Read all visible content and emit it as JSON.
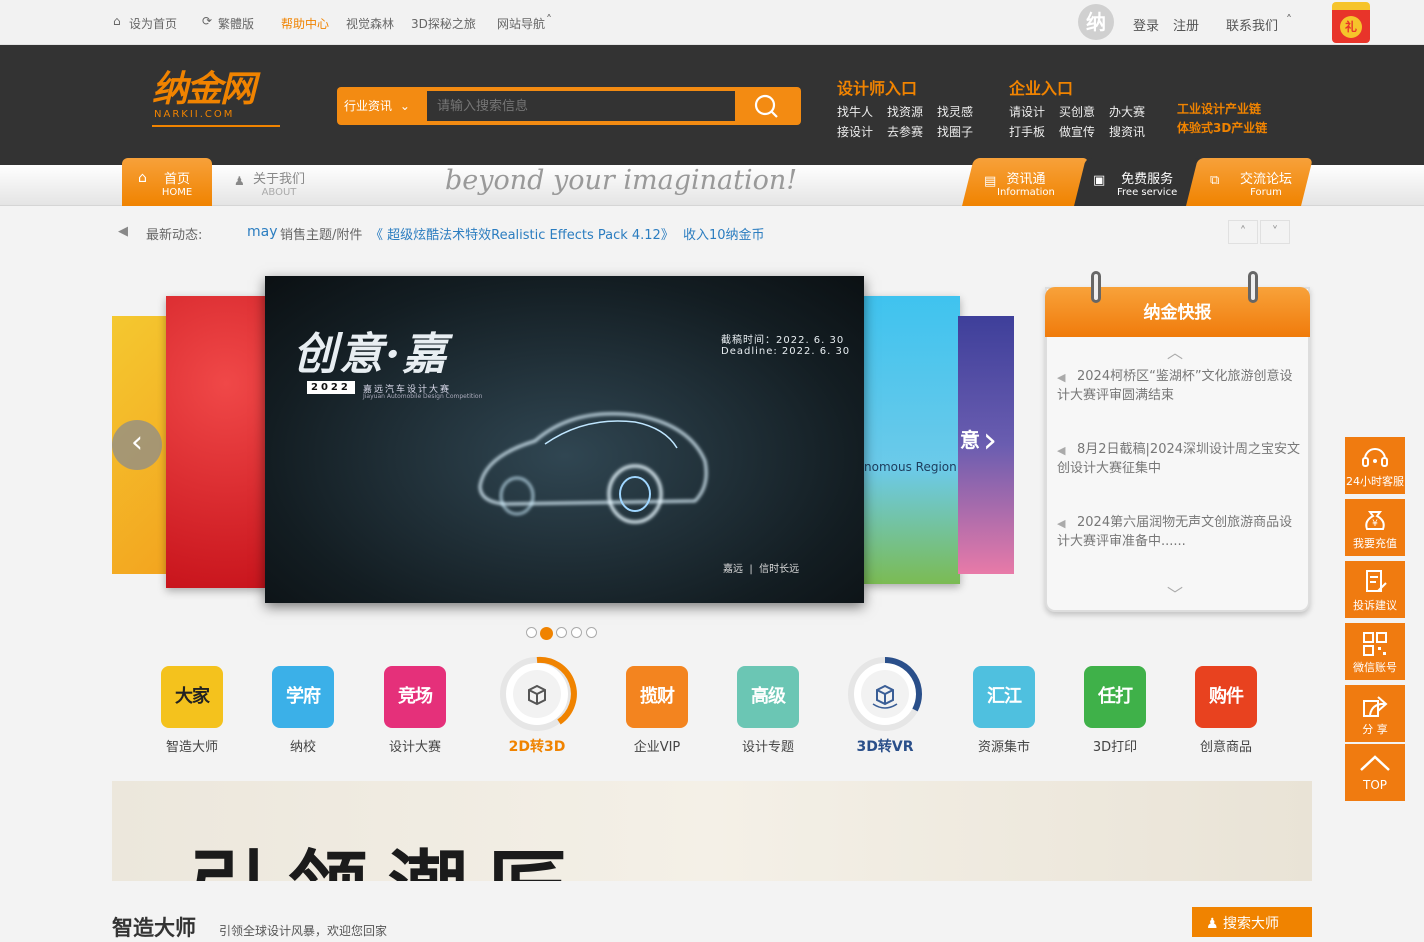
{
  "topbar": {
    "homepage": "设为首页",
    "traditional": "繁體版",
    "help": "帮助中心",
    "visual": "视觉森林",
    "explore3d": "3D探秘之旅",
    "sitenav": "网站导航",
    "login": "登录",
    "register": "注册",
    "contact": "联系我们",
    "avatar_text": "纳",
    "gift_text": "礼"
  },
  "header": {
    "logo": "纳金网",
    "logo_sub": "NARKII.COM",
    "search": {
      "category": "行业资讯",
      "placeholder": "请输入搜索信息"
    },
    "designer": {
      "title": "设计师入口",
      "links": [
        "找牛人",
        "找资源",
        "找灵感",
        "接设计",
        "去参赛",
        "找圈子"
      ]
    },
    "enterprise": {
      "title": "企业入口",
      "links": [
        "请设计",
        "买创意",
        "办大赛",
        "打手板",
        "做宣传",
        "搜资讯"
      ]
    },
    "extra": [
      "工业设计产业链",
      "体验式3D产业链"
    ]
  },
  "nav": {
    "home": "首页",
    "home_en": "HOME",
    "about": "关于我们",
    "about_en": "ABOUT",
    "slogan": "beyond your imagination!",
    "tabs": [
      {
        "cn": "资讯通",
        "en": "Information"
      },
      {
        "cn": "免费服务",
        "en": "Free service"
      },
      {
        "cn": "交流论坛",
        "en": "Forum"
      }
    ]
  },
  "news": {
    "label": "最新动态:",
    "user": "may",
    "action": "销售主题/附件",
    "item": "《 超级炫酷法术特效Realistic Effects Pack 4.12》",
    "reward": "收入10纳金币"
  },
  "banner": {
    "title": "创意·嘉",
    "year": "2022",
    "subtitle": "嘉远汽车设计大赛",
    "subtitle_en": "Jiayuan Automobile Design Competition",
    "deadline_label": "截稿时间：",
    "deadline": "2022. 6. 30",
    "deadline_en": "Deadline: 2022. 6. 30",
    "side_text": "nomous Region",
    "brand1": "嘉远",
    "brand2": "信时长远",
    "side_char": "意"
  },
  "flash": {
    "title": "纳金快报",
    "items": [
      "2024柯桥区“鉴湖杯”文化旅游创意设计大赛评审圆满结束",
      "8月2日截稿|2024深圳设计周之宝安文创设计大赛征集中",
      "2024第六届润物无声文创旅游商品设计大赛评审准备中......"
    ]
  },
  "categories": [
    {
      "label": "智造大师",
      "icon": "大家",
      "color": "#f4c21d"
    },
    {
      "label": "纳校",
      "icon": "学府",
      "color": "#3bb0e8"
    },
    {
      "label": "设计大赛",
      "icon": "竞场",
      "color": "#e5307a"
    },
    {
      "label": "2D转3D",
      "icon": "",
      "color": "#f08300"
    },
    {
      "label": "企业VIP",
      "icon": "揽财",
      "color": "#f3841f"
    },
    {
      "label": "设计专题",
      "icon": "高级",
      "color": "#6bc6b4"
    },
    {
      "label": "3D转VR",
      "icon": "",
      "color": "#2a4f8a"
    },
    {
      "label": "资源集市",
      "icon": "汇江",
      "color": "#4fc0df"
    },
    {
      "label": "3D打印",
      "icon": "任打",
      "color": "#3fb149"
    },
    {
      "label": "创意商品",
      "icon": "购件",
      "color": "#e8421f"
    }
  ],
  "sidebar": [
    {
      "label": "24小时客服"
    },
    {
      "label": "我要充值"
    },
    {
      "label": "投诉建议"
    },
    {
      "label": "微信账号"
    },
    {
      "label": "分 享"
    },
    {
      "label": "TOP"
    }
  ],
  "promo": {
    "text": "引领潮匠"
  },
  "bottom": {
    "title": "智造大师",
    "subtitle": "引领全球设计风暴，欢迎您回家",
    "button": "搜索大师"
  }
}
